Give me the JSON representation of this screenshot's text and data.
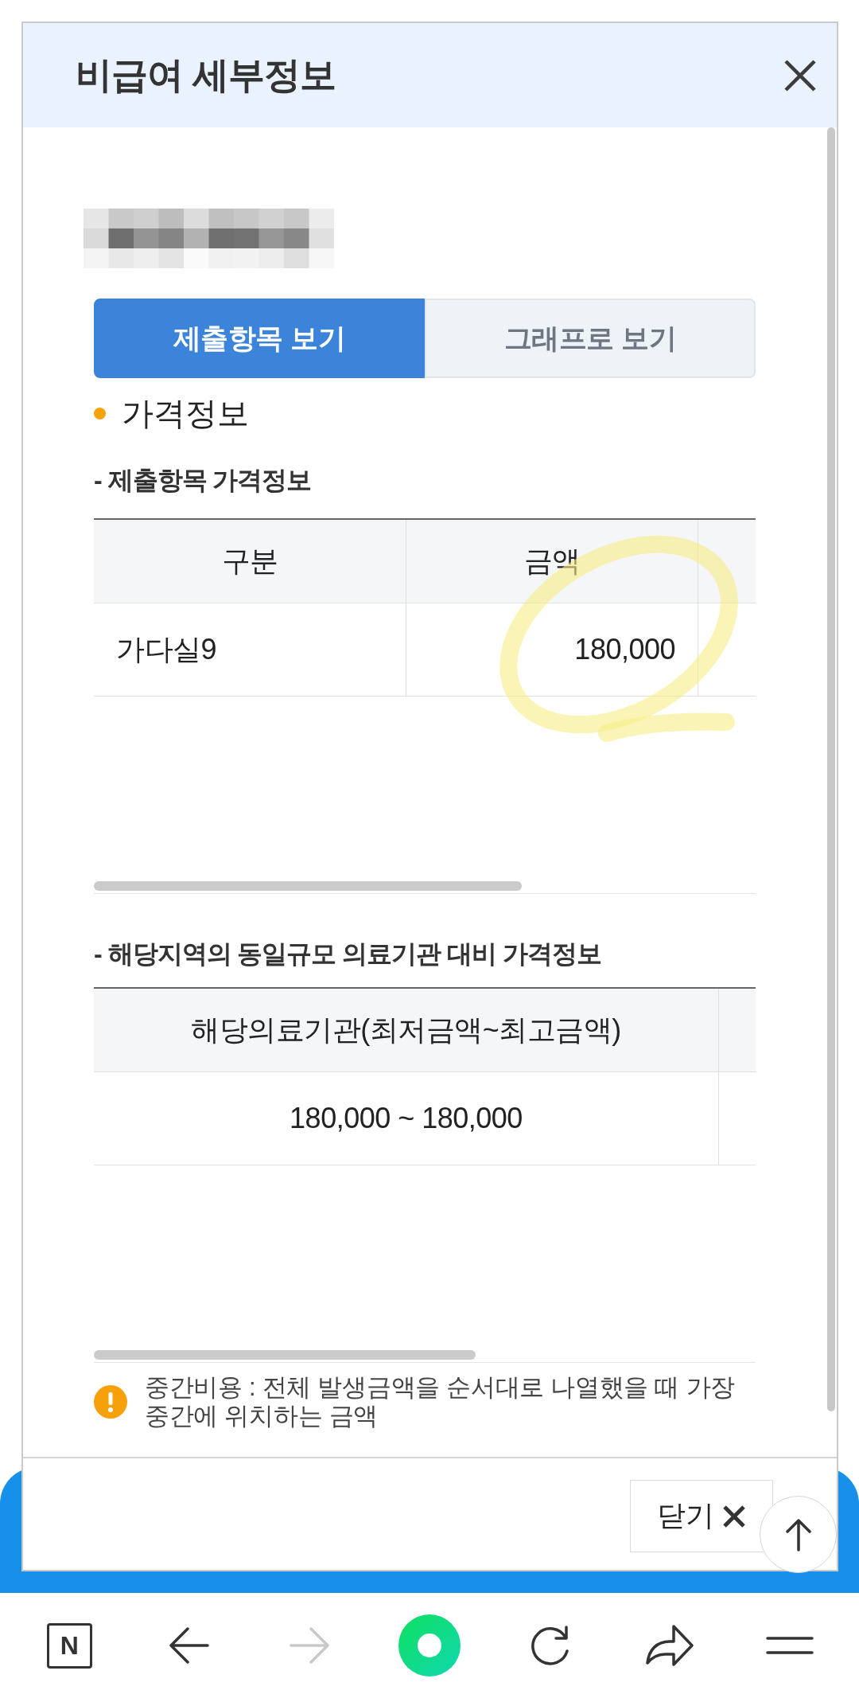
{
  "dialog": {
    "title": "비급여 세부정보"
  },
  "tabs": [
    {
      "label": "제출항목 보기",
      "selected": true
    },
    {
      "label": "그래프로 보기",
      "selected": false
    }
  ],
  "section": {
    "title": "가격정보"
  },
  "submitted_prices": {
    "title": "- 제출항목 가격정보",
    "columns": [
      "구분",
      "금액"
    ],
    "rows": [
      [
        "가다실9",
        "180,000"
      ]
    ]
  },
  "regional_prices": {
    "title": "- 해당지역의 동일규모 의료기관 대비 가격정보",
    "columns": [
      "해당의료기관(최저금액~최고금액)"
    ],
    "rows": [
      [
        "180,000 ~ 180,000"
      ]
    ]
  },
  "note": {
    "text": "중간비용 : 전체 발생금액을 순서대로 나열했을 때 가장 중간에 위치하는 금액"
  },
  "close_button": {
    "label": "닫기"
  },
  "nav": {
    "home_logo": "N",
    "forward_enabled": false
  }
}
